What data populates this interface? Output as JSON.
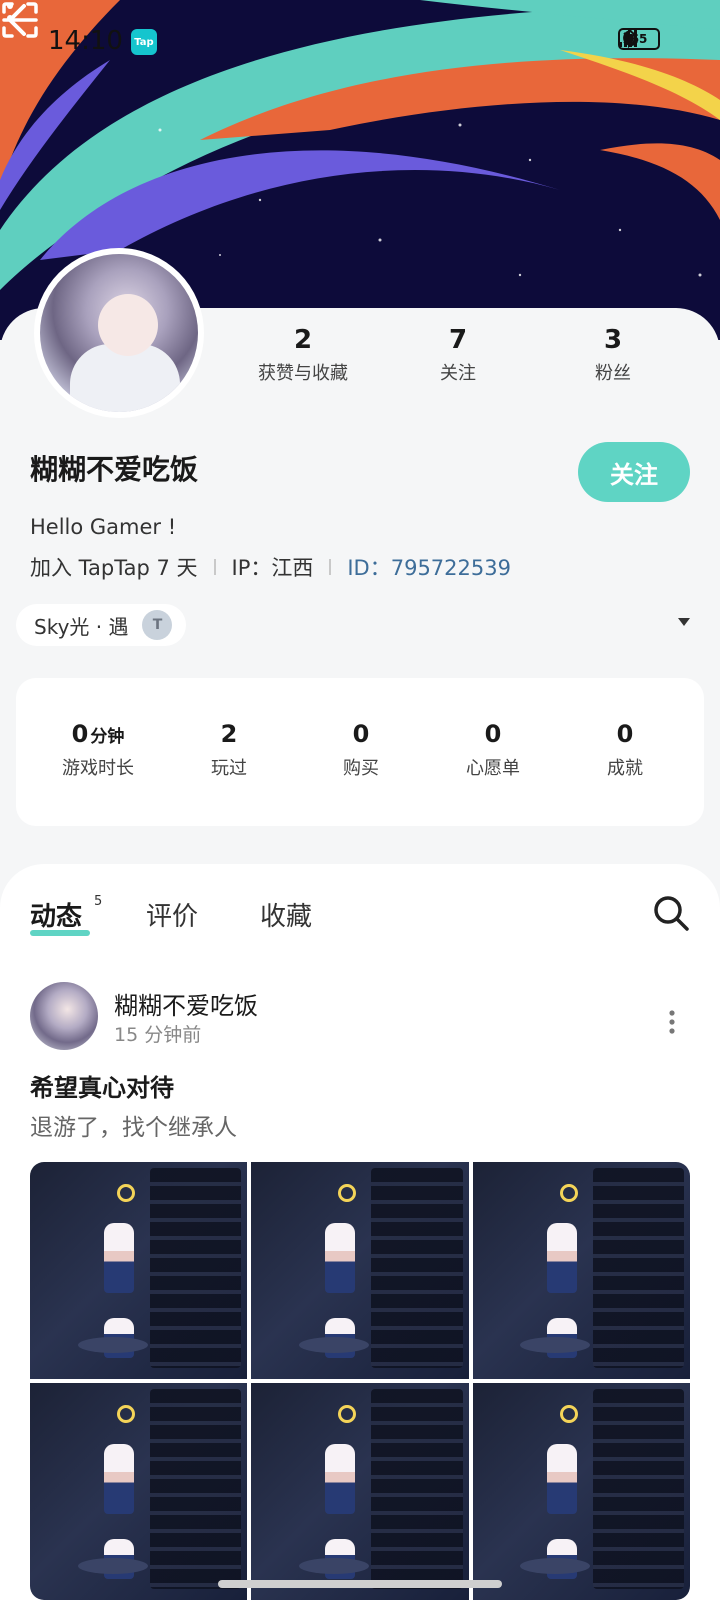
{
  "status_bar": {
    "time": "14:10",
    "app_badge": "Tap",
    "battery": "65"
  },
  "header": {
    "back_icon": "back-arrow-icon",
    "scan_icon": "scan-icon",
    "more_icon": "more-vertical-icon",
    "colors": {
      "bg": "#0d0b3a",
      "orange": "#e8673a",
      "teal": "#5fcfbf",
      "purple": "#6a5bdc",
      "yellow": "#f3d34a"
    }
  },
  "profile": {
    "stats": [
      {
        "value": "2",
        "label": "获赞与收藏"
      },
      {
        "value": "7",
        "label": "关注"
      },
      {
        "value": "3",
        "label": "粉丝"
      }
    ],
    "name": "糊糊不爱吃饭",
    "follow_label": "关注",
    "bio": "Hello Gamer !",
    "joined": "加入 TapTap 7 天",
    "ip": "IP：江西",
    "id": "ID：795722539",
    "game_chip": "Sky光 · 遇",
    "game_chip_icon": "T"
  },
  "game_stats": [
    {
      "value": "0",
      "unit": "分钟",
      "label": "游戏时长"
    },
    {
      "value": "2",
      "unit": "",
      "label": "玩过"
    },
    {
      "value": "0",
      "unit": "",
      "label": "购买"
    },
    {
      "value": "0",
      "unit": "",
      "label": "心愿单"
    },
    {
      "value": "0",
      "unit": "",
      "label": "成就"
    }
  ],
  "tabs": [
    {
      "label": "动态",
      "count": "5"
    },
    {
      "label": "评价"
    },
    {
      "label": "收藏"
    }
  ],
  "post": {
    "author": "糊糊不爱吃饭",
    "time": "15 分钟前",
    "title": "希望真心对待",
    "body": "退游了，找个继承人"
  },
  "colors": {
    "accent": "#5fd4c4",
    "id_link": "#3d6d99"
  }
}
